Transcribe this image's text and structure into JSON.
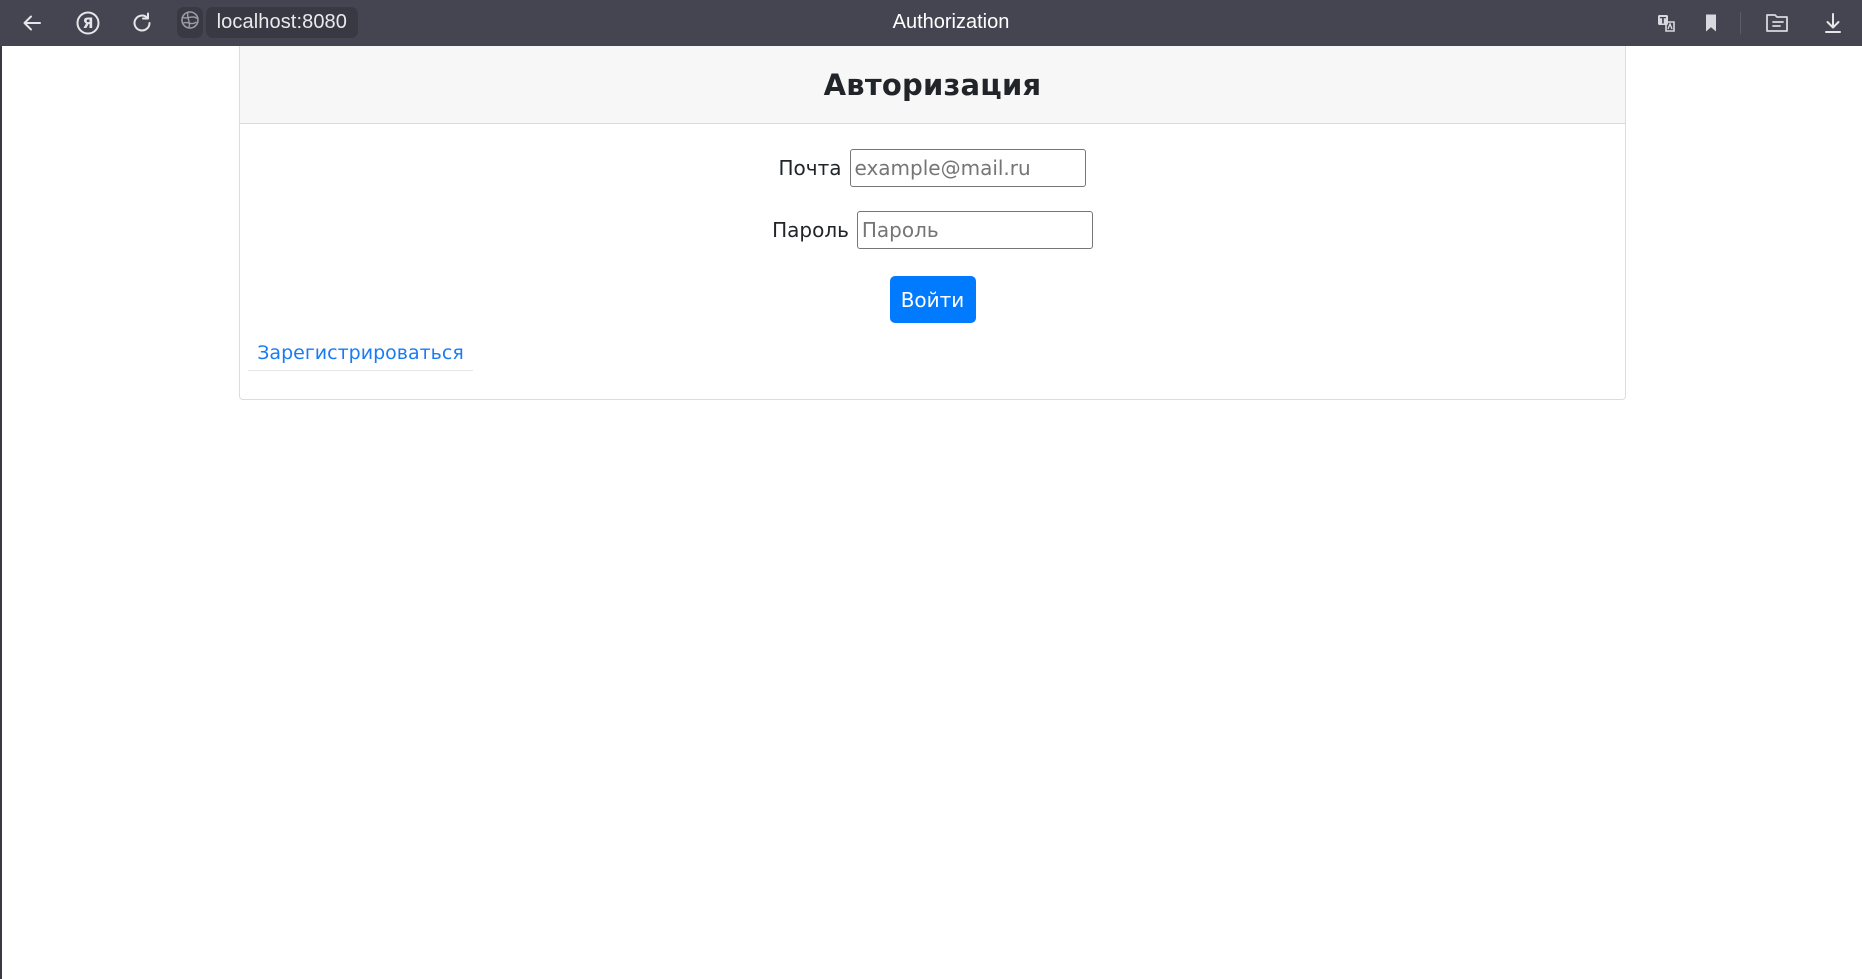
{
  "browser": {
    "url": "localhost:8080",
    "tab_title": "Authorization",
    "icons": {
      "back": "arrow-left-icon",
      "home": "yandex-icon",
      "reload": "reload-icon",
      "site": "globe-icon",
      "translate": "translate-icon",
      "bookmark": "bookmark-icon",
      "reader": "reader-icon",
      "downloads": "download-icon"
    }
  },
  "page": {
    "title": "Авторизация",
    "email_label": "Почта",
    "email_placeholder": "example@mail.ru",
    "email_value": "",
    "password_label": "Пароль",
    "password_placeholder": "Пароль",
    "password_value": "",
    "submit_label": "Войти",
    "register_link": "Зарегистрироваться"
  },
  "colors": {
    "toolbar_bg": "#454552",
    "primary_button": "#007bff",
    "link": "#1a7cf5",
    "card_header_bg": "#f7f7f7"
  }
}
